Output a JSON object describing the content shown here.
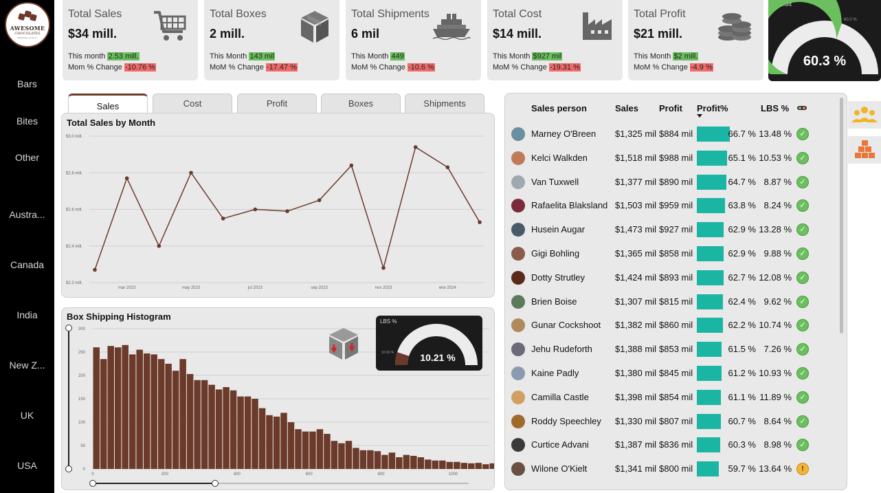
{
  "logo": {
    "line1": "AWESOME",
    "line2": "CHOCOLATES",
    "line3": "PREMIUM • QUALITY"
  },
  "nav": [
    "Bars",
    "Bites",
    "Other",
    "Austra...",
    "Canada",
    "India",
    "New Z...",
    "UK",
    "USA"
  ],
  "kpis": [
    {
      "label": "Total Sales",
      "value": "$34 mill.",
      "row1_label": "This month",
      "row1_value": "2.53 mill.",
      "row2_label": "Mom % Change",
      "row2_value": "-10.76 %",
      "icon": "shopping-cart-icon"
    },
    {
      "label": "Total Boxes",
      "value": "2 mill.",
      "row1_label": "This Month",
      "row1_value": "143 mil",
      "row2_label": "MoM % Change",
      "row2_value": "-17.47 %",
      "icon": "box-icon"
    },
    {
      "label": "Total Shipments",
      "value": "6 mil",
      "row1_label": "This Month",
      "row1_value": "449",
      "row2_label": "MoM % Change",
      "row2_value": "-10.6 %",
      "icon": "ship-icon"
    },
    {
      "label": "Total Cost",
      "value": "$14 mill.",
      "row1_label": "This Month",
      "row1_value": "$927 mil",
      "row2_label": "MoM % Change",
      "row2_value": "-19.31 %",
      "icon": "factory-icon"
    },
    {
      "label": "Total Profit",
      "value": "$21 mill.",
      "row1_label": "This Month",
      "row1_value": "$2 mill.",
      "row2_label": "MoM % Change",
      "row2_value": "-4.9 %",
      "icon": "coins-icon"
    }
  ],
  "profit_gauge": {
    "title": "% Profit",
    "value": "60.3 %",
    "target_label": "60.0 %",
    "fraction": 0.603
  },
  "tabs": [
    "Sales",
    "Cost",
    "Profit",
    "Boxes",
    "Shipments"
  ],
  "active_tab": 0,
  "chart_data": [
    {
      "type": "line",
      "title": "Total Sales by Month",
      "x": [
        "feb 2023",
        "mar 2023",
        "abr 2023",
        "may 2023",
        "jun 2023",
        "jul 2023",
        "ago 2023",
        "sep 2023",
        "oct 2023",
        "nov 2023",
        "dic 2023",
        "ene 2024",
        "feb 2024"
      ],
      "x_ticks": [
        "mar 2023",
        "may 2023",
        "jul 2023",
        "sep 2023",
        "nov 2023",
        "ene 2024"
      ],
      "values": [
        2.27,
        2.77,
        2.4,
        2.8,
        2.55,
        2.6,
        2.59,
        2.65,
        2.84,
        2.28,
        2.94,
        2.83,
        2.53
      ],
      "y_ticks": [
        "$2.2 mill.",
        "$2.4 mill.",
        "$2.6 mill.",
        "$2.8 mill.",
        "$3.0 mill."
      ],
      "ylim": [
        2.2,
        3.0
      ],
      "grid": true,
      "color": "#6b3a2a"
    },
    {
      "type": "bar",
      "title": "Box Shipping Histogram",
      "bin_width": 20,
      "values": [
        260,
        235,
        263,
        260,
        265,
        245,
        255,
        247,
        245,
        235,
        225,
        210,
        235,
        203,
        190,
        190,
        180,
        170,
        175,
        168,
        155,
        155,
        150,
        130,
        115,
        112,
        120,
        100,
        85,
        80,
        80,
        85,
        75,
        60,
        55,
        60,
        45,
        40,
        40,
        38,
        30,
        35,
        25,
        30,
        28,
        25,
        20,
        18,
        18,
        15,
        15,
        13,
        12,
        13,
        10,
        12,
        10
      ],
      "x_ticks": [
        "0",
        "200",
        "400",
        "600",
        "800",
        "1000"
      ],
      "x_tick_values": [
        0,
        200,
        400,
        600,
        800,
        1000
      ],
      "y_ticks": [
        "0",
        "50",
        "100",
        "150",
        "200",
        "250",
        "300"
      ],
      "ylim": [
        0,
        300
      ],
      "xlim": [
        0,
        1100
      ],
      "color": "#6b3a2a"
    }
  ],
  "lbs_gauge": {
    "title": "LBS %",
    "value": "10.21 %",
    "target_label": "10.00 %",
    "fraction": 0.1021
  },
  "table": {
    "headers": {
      "name": "Sales person",
      "sales": "Sales",
      "profit": "Profit",
      "profit_pct": "Profit%",
      "lbs": "LBS %"
    },
    "rows": [
      {
        "name": "Marney O'Breen",
        "sales": "$1,325 mil",
        "profit": "$884 mil",
        "pct": "66.7 %",
        "pct_value": 66.7,
        "lbs": "13.48 %",
        "status": "ok",
        "avatar": "#6b8fa0"
      },
      {
        "name": "Kelci Walkden",
        "sales": "$1,518 mil",
        "profit": "$988 mil",
        "pct": "65.1 %",
        "pct_value": 65.1,
        "lbs": "10.53 %",
        "status": "ok",
        "avatar": "#c07a5a"
      },
      {
        "name": "Van Tuxwell",
        "sales": "$1,377 mil",
        "profit": "$890 mil",
        "pct": "64.7 %",
        "pct_value": 64.7,
        "lbs": "8.87 %",
        "status": "ok",
        "avatar": "#a0a8b0"
      },
      {
        "name": "Rafaelita Blaksland",
        "sales": "$1,503 mil",
        "profit": "$959 mil",
        "pct": "63.8 %",
        "pct_value": 63.8,
        "lbs": "8.24 %",
        "status": "ok",
        "avatar": "#7a2a3a"
      },
      {
        "name": "Husein Augar",
        "sales": "$1,473 mil",
        "profit": "$927 mil",
        "pct": "62.9 %",
        "pct_value": 62.9,
        "lbs": "13.28 %",
        "status": "ok",
        "avatar": "#4a5a6a"
      },
      {
        "name": "Gigi Bohling",
        "sales": "$1,365 mil",
        "profit": "$858 mil",
        "pct": "62.9 %",
        "pct_value": 62.9,
        "lbs": "9.88 %",
        "status": "ok",
        "avatar": "#8a5a4a"
      },
      {
        "name": "Dotty Strutley",
        "sales": "$1,424 mil",
        "profit": "$893 mil",
        "pct": "62.7 %",
        "pct_value": 62.7,
        "lbs": "12.08 %",
        "status": "ok",
        "avatar": "#5a2a1a"
      },
      {
        "name": "Brien Boise",
        "sales": "$1,307 mil",
        "profit": "$815 mil",
        "pct": "62.4 %",
        "pct_value": 62.4,
        "lbs": "9.62 %",
        "status": "ok",
        "avatar": "#5a7a5a"
      },
      {
        "name": "Gunar Cockshoot",
        "sales": "$1,382 mil",
        "profit": "$860 mil",
        "pct": "62.2 %",
        "pct_value": 62.2,
        "lbs": "10.74 %",
        "status": "ok",
        "avatar": "#b08a5a"
      },
      {
        "name": "Jehu Rudeforth",
        "sales": "$1,388 mil",
        "profit": "$853 mil",
        "pct": "61.5 %",
        "pct_value": 61.5,
        "lbs": "7.26 %",
        "status": "ok",
        "avatar": "#6a6a7a"
      },
      {
        "name": "Kaine Padly",
        "sales": "$1,380 mil",
        "profit": "$845 mil",
        "pct": "61.2 %",
        "pct_value": 61.2,
        "lbs": "10.93 %",
        "status": "ok",
        "avatar": "#8a9ab0"
      },
      {
        "name": "Camilla Castle",
        "sales": "$1,398 mil",
        "profit": "$854 mil",
        "pct": "61.1 %",
        "pct_value": 61.1,
        "lbs": "11.89 %",
        "status": "ok",
        "avatar": "#d0a060"
      },
      {
        "name": "Roddy Speechley",
        "sales": "$1,330 mil",
        "profit": "$807 mil",
        "pct": "60.7 %",
        "pct_value": 60.7,
        "lbs": "8.64 %",
        "status": "ok",
        "avatar": "#a06a2a"
      },
      {
        "name": "Curtice Advani",
        "sales": "$1,387 mil",
        "profit": "$836 mil",
        "pct": "60.3 %",
        "pct_value": 60.3,
        "lbs": "8.98 %",
        "status": "ok",
        "avatar": "#3a3a3a"
      },
      {
        "name": "Wilone O'Kielt",
        "sales": "$1,341 mil",
        "profit": "$800 mil",
        "pct": "59.7 %",
        "pct_value": 59.7,
        "lbs": "13.64 %",
        "status": "warn",
        "avatar": "#6a5040"
      }
    ]
  },
  "side_buttons": [
    "people-icon",
    "boxes-icon"
  ],
  "colors": {
    "accent": "#6b3a2a",
    "teal": "#1bb5a4",
    "green": "#6bbf5e",
    "red": "#f06a6a",
    "gauge_fill": "#6bbf5e"
  }
}
